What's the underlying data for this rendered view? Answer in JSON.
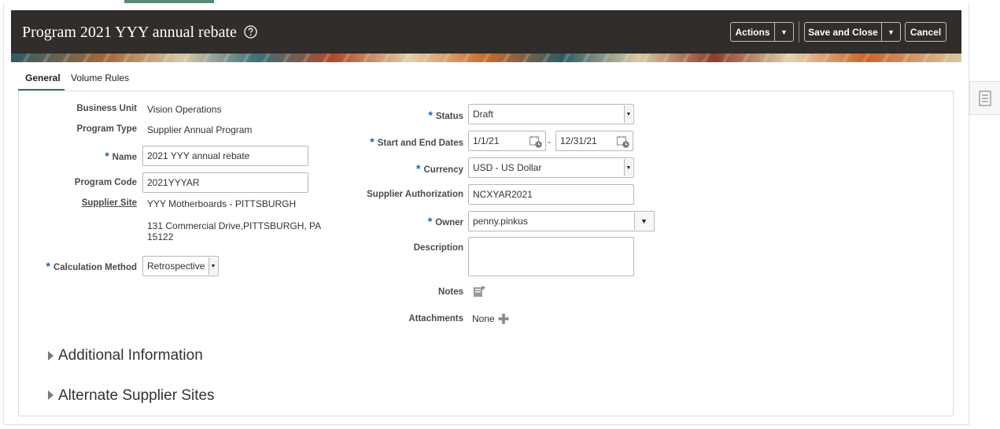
{
  "header": {
    "title": "Program 2021 YYY annual rebate",
    "actions_label": "Actions",
    "save_close_label": "Save and Close",
    "cancel_label": "Cancel"
  },
  "tabs": [
    {
      "label": "General",
      "selected": true
    },
    {
      "label": "Volume Rules",
      "selected": false
    }
  ],
  "form_left": {
    "business_unit": {
      "label": "Business Unit",
      "value": "Vision Operations"
    },
    "program_type": {
      "label": "Program Type",
      "value": "Supplier Annual Program"
    },
    "name": {
      "label": "Name",
      "value": "2021 YYY annual rebate"
    },
    "program_code": {
      "label": "Program Code",
      "value": "2021YYYAR"
    },
    "supplier_site": {
      "label": "Supplier Site",
      "value": "YYY Motherboards - PITTSBURGH",
      "address_line1": "131 Commercial Drive,PITTSBURGH, PA",
      "address_line2": "15122"
    },
    "calculation_method": {
      "label": "Calculation Method",
      "value": "Retrospective"
    }
  },
  "form_right": {
    "status": {
      "label": "Status",
      "value": "Draft"
    },
    "dates": {
      "label": "Start and End Dates",
      "start": "1/1/21",
      "separator": "-",
      "end": "12/31/21"
    },
    "currency": {
      "label": "Currency",
      "value": "USD - US Dollar"
    },
    "supplier_authorization": {
      "label": "Supplier Authorization",
      "value": "NCXYAR2021"
    },
    "owner": {
      "label": "Owner",
      "value": "penny.pinkus"
    },
    "description": {
      "label": "Description",
      "value": ""
    },
    "notes": {
      "label": "Notes"
    },
    "attachments": {
      "label": "Attachments",
      "value": "None"
    }
  },
  "sections": {
    "additional_info": "Additional Information",
    "alternate_sites": "Alternate Supplier Sites"
  },
  "required_marker": "*",
  "colors": {
    "header_bg": "#302d2b",
    "tab_underline": "#3b7360",
    "required_marker": "#1f5fa6"
  }
}
